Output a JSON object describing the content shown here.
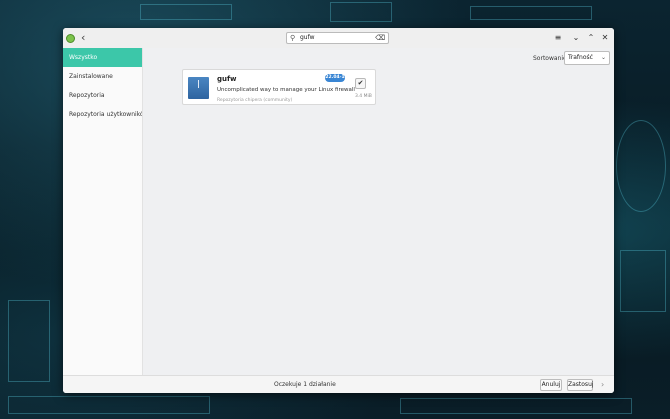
{
  "window": {
    "back_icon": "‹",
    "window_buttons": [
      "≡",
      "⌄",
      "⌃",
      "✕"
    ]
  },
  "search": {
    "icon": "⚲",
    "value": "gufw",
    "clear_icon": "⌫"
  },
  "sidebar": {
    "items": [
      {
        "label": "Wszystko",
        "active": true
      },
      {
        "label": "Zainstalowane",
        "active": false
      },
      {
        "label": "Repozytoria",
        "active": false
      },
      {
        "label": "Repozytoria użytkowników Arch",
        "active": false
      }
    ]
  },
  "toolbar": {
    "sort_label": "Sortowanie",
    "sort_value": "Trafność",
    "sort_chevron": "⌄"
  },
  "package": {
    "name": "gufw",
    "version": "22.04-1",
    "description": "Uncomplicated way to manage your Linux firewall",
    "repository": "Repozytoria chipera (community)",
    "size": "3.4 MiB",
    "selected_mark": "✔"
  },
  "footer": {
    "status": "Oczekuje 1 działanie",
    "cancel_label": "Anuluj",
    "apply_label": "Zastosuj",
    "next_icon": "›"
  },
  "colors": {
    "accent": "#3cc7a9",
    "badge": "#3a86d4"
  }
}
